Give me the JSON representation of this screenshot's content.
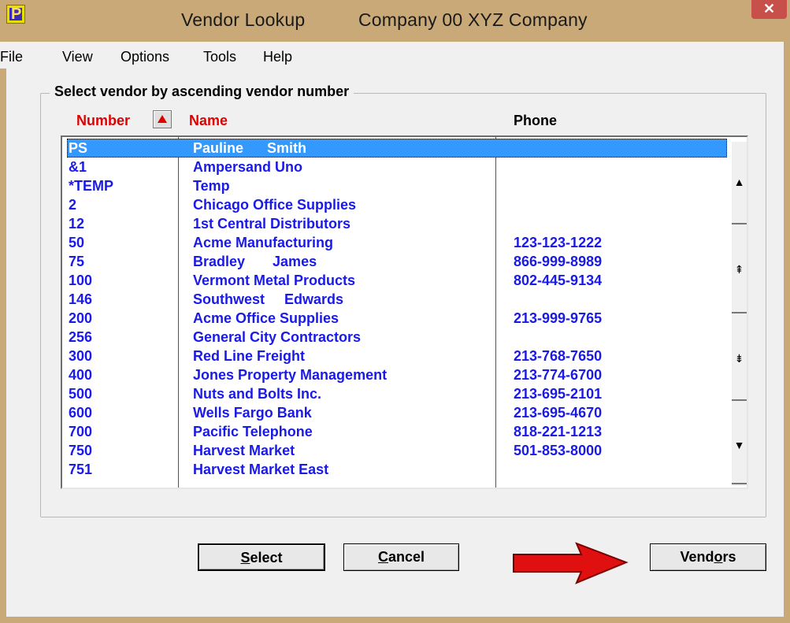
{
  "window": {
    "title_left": "Vendor Lookup",
    "title_right": "Company 00  XYZ Company",
    "close_label": "✕"
  },
  "menu": [
    {
      "label": "File"
    },
    {
      "label": "View"
    },
    {
      "label": "Options"
    },
    {
      "label": "Tools"
    },
    {
      "label": "Help"
    }
  ],
  "group_title": "Select vendor by ascending vendor number",
  "columns": {
    "number": "Number",
    "name": "Name",
    "phone": "Phone"
  },
  "rows": [
    {
      "number": "PS",
      "name": "Pauline      Smith",
      "phone": "",
      "selected": true
    },
    {
      "number": "&1",
      "name": "Ampersand Uno",
      "phone": ""
    },
    {
      "number": "*TEMP",
      "name": "Temp",
      "phone": ""
    },
    {
      "number": "2",
      "name": "Chicago Office Supplies",
      "phone": ""
    },
    {
      "number": "12",
      "name": "1st Central Distributors",
      "phone": ""
    },
    {
      "number": "50",
      "name": "Acme Manufacturing",
      "phone": "123-123-1222"
    },
    {
      "number": "75",
      "name": "Bradley       James",
      "phone": "866-999-8989"
    },
    {
      "number": "100",
      "name": "Vermont Metal Products",
      "phone": "802-445-9134"
    },
    {
      "number": "146",
      "name": "Southwest     Edwards",
      "phone": ""
    },
    {
      "number": "200",
      "name": "Acme Office Supplies",
      "phone": "213-999-9765"
    },
    {
      "number": "256",
      "name": "General City Contractors",
      "phone": ""
    },
    {
      "number": "300",
      "name": "Red Line Freight",
      "phone": "213-768-7650"
    },
    {
      "number": "400",
      "name": "Jones Property Management",
      "phone": "213-774-6700"
    },
    {
      "number": "500",
      "name": "Nuts and Bolts Inc.",
      "phone": "213-695-2101"
    },
    {
      "number": "600",
      "name": "Wells Fargo Bank",
      "phone": "213-695-4670"
    },
    {
      "number": "700",
      "name": "Pacific Telephone",
      "phone": "818-221-1213"
    },
    {
      "number": "750",
      "name": "Harvest Market",
      "phone": "501-853-8000"
    },
    {
      "number": "751",
      "name": "Harvest Market East",
      "phone": ""
    }
  ],
  "buttons": {
    "select": {
      "pre": "",
      "key": "S",
      "post": "elect"
    },
    "cancel": {
      "pre": "",
      "key": "C",
      "post": "ancel"
    },
    "vendors": {
      "pre": "Vend",
      "key": "o",
      "post": "rs"
    }
  },
  "colors": {
    "list_text": "#1a1ae6",
    "header_red": "#e00000",
    "selection": "#3399ff",
    "arrow": "#e01010"
  }
}
